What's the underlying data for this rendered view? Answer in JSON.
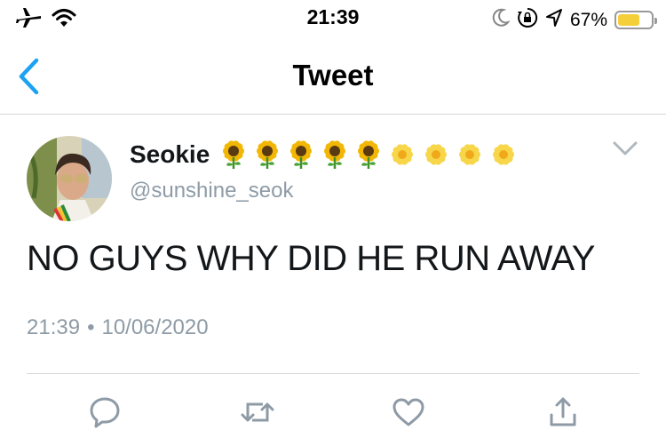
{
  "status_bar": {
    "time": "21:39",
    "battery_percent": "67%",
    "battery_level": 0.67,
    "colors": {
      "battery_fill": "#f5cf3a"
    },
    "icons": [
      "airplane-icon",
      "wifi-icon",
      "moon-icon",
      "orientation-lock-icon",
      "location-icon",
      "battery-icon"
    ]
  },
  "nav": {
    "title": "Tweet",
    "back_icon": "chevron-left-icon",
    "accent": "#1da1f2"
  },
  "tweet": {
    "display_name": "Seokie",
    "name_emojis": [
      "sunflower",
      "sunflower",
      "sunflower",
      "sunflower",
      "sunflower",
      "blossom",
      "blossom",
      "blossom",
      "blossom"
    ],
    "handle": "@sunshine_seok",
    "text": "NO GUYS WHY DID HE RUN AWAY",
    "time": "21:39",
    "separator": "•",
    "date": "10/06/2020",
    "menu_icon": "chevron-down-icon"
  },
  "actions": [
    "reply-icon",
    "retweet-icon",
    "like-icon",
    "share-icon"
  ]
}
